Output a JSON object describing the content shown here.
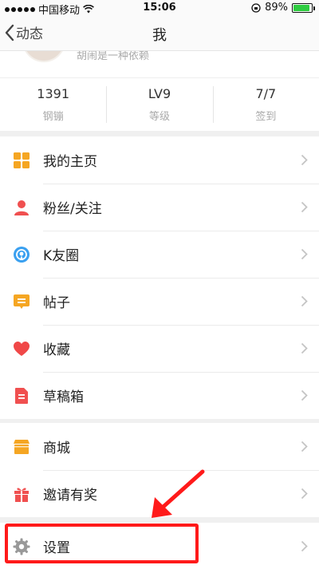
{
  "status": {
    "carrier": "中国移动",
    "time": "15:06",
    "battery": "89%",
    "battery_level": 0.89
  },
  "nav": {
    "back_label": "动态",
    "title": "我"
  },
  "profile": {
    "subtitle": "胡闹是一种依赖"
  },
  "stats": [
    {
      "value": "1391",
      "label": "钢镚"
    },
    {
      "value": "LV9",
      "label": "等级"
    },
    {
      "value": "7/7",
      "label": "签到"
    }
  ],
  "menu": [
    {
      "label": "我的主页",
      "icon": "grid-icon",
      "color": "#f5a623"
    },
    {
      "label": "粉丝/关注",
      "icon": "person-icon",
      "color": "#f05050"
    },
    {
      "label": "K友圈",
      "icon": "broadcast-icon",
      "color": "#3aa0f0"
    },
    {
      "label": "帖子",
      "icon": "chat-bubble-icon",
      "color": "#f5a623"
    },
    {
      "label": "收藏",
      "icon": "heart-icon",
      "color": "#f04848"
    },
    {
      "label": "草稿箱",
      "icon": "document-icon",
      "color": "#f05050"
    }
  ],
  "menu2": [
    {
      "label": "商城",
      "icon": "shop-icon",
      "color": "#f5a623"
    },
    {
      "label": "邀请有奖",
      "icon": "gift-icon",
      "color": "#f05050"
    }
  ],
  "menu3": [
    {
      "label": "设置",
      "icon": "gear-icon",
      "color": "#999999"
    }
  ]
}
